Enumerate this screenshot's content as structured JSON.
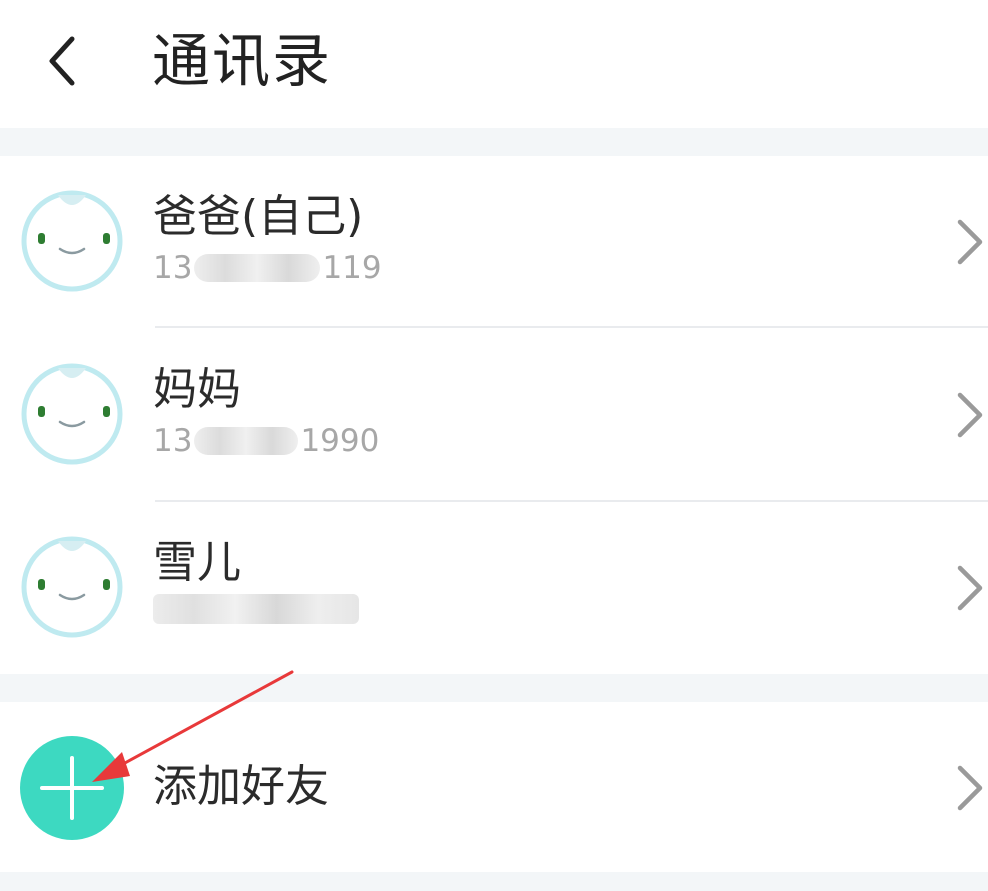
{
  "header": {
    "title": "通讯录",
    "back_icon": "chevron-left-icon"
  },
  "contacts": [
    {
      "name": "爸爸(自己)",
      "phone_prefix": "13",
      "phone_suffix": "119",
      "avatar_icon": "smiley-avatar-icon"
    },
    {
      "name": "妈妈",
      "phone_prefix": "13",
      "phone_suffix": "1990",
      "avatar_icon": "smiley-avatar-icon"
    },
    {
      "name": "雪儿",
      "phone_prefix": "",
      "phone_suffix": "",
      "avatar_icon": "smiley-avatar-icon"
    }
  ],
  "add_friend": {
    "label": "添加好友",
    "icon": "plus-icon"
  },
  "colors": {
    "accent": "#3dd9c1",
    "avatar_ring": "#bfeaf0",
    "annotation_arrow": "#e8393a",
    "background": "#f3f6f8"
  }
}
